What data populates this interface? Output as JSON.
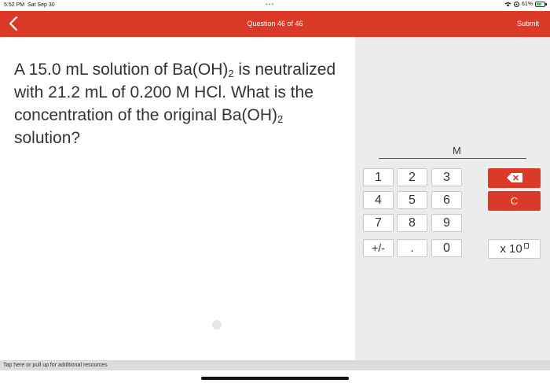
{
  "status": {
    "time": "5:52 PM",
    "date": "Sat Sep 30",
    "dots": "•••",
    "battery_pct": "61%"
  },
  "header": {
    "title": "Question 46 of 46",
    "submit_label": "Submit"
  },
  "question": {
    "text_1": "A 15.0 mL solution of Ba(OH)",
    "sub_1": "2",
    "text_2": " is neutralized with 21.2 mL of 0.200 M HCl. What is the concentration of the original Ba(OH)",
    "sub_2": "2",
    "text_3": " solution?"
  },
  "answer": {
    "unit": "M"
  },
  "keypad": {
    "k1": "1",
    "k2": "2",
    "k3": "3",
    "k4": "4",
    "k5": "5",
    "k6": "6",
    "k7": "7",
    "k8": "8",
    "k9": "9",
    "sign": "+/-",
    "dot": ".",
    "k0": "0",
    "clear": "C",
    "sci": "x 10"
  },
  "footer": {
    "resources_text": "Tap here or pull up for additional resources"
  },
  "colors": {
    "accent": "#dc3a28",
    "panel": "#ececec"
  }
}
